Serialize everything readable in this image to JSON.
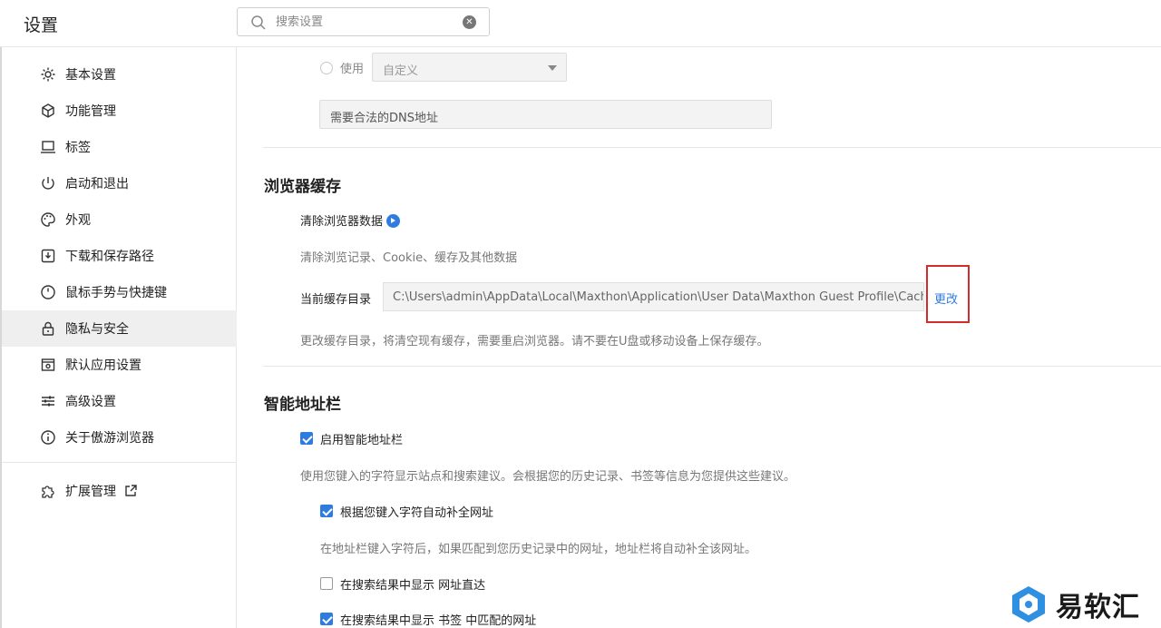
{
  "header": {
    "title": "设置",
    "search_placeholder": "搜索设置"
  },
  "sidebar": {
    "items": [
      {
        "label": "基本设置",
        "icon": "gear-icon"
      },
      {
        "label": "功能管理",
        "icon": "cube-icon"
      },
      {
        "label": "标签",
        "icon": "laptop-icon"
      },
      {
        "label": "启动和退出",
        "icon": "power-icon"
      },
      {
        "label": "外观",
        "icon": "palette-icon"
      },
      {
        "label": "下载和保存路径",
        "icon": "download-icon"
      },
      {
        "label": "鼠标手势与快捷键",
        "icon": "mouse-icon"
      },
      {
        "label": "隐私与安全",
        "icon": "lock-icon",
        "active": true
      },
      {
        "label": "默认应用设置",
        "icon": "default-app-icon"
      },
      {
        "label": "高级设置",
        "icon": "sliders-icon"
      },
      {
        "label": "关于傲游浏览器",
        "icon": "info-icon"
      }
    ],
    "extensions": {
      "label": "扩展管理",
      "icon": "puzzle-icon"
    }
  },
  "dns": {
    "radio_label": "使用",
    "select_value": "自定义",
    "input_placeholder": "需要合法的DNS地址"
  },
  "cache": {
    "title": "浏览器缓存",
    "clear_label": "清除浏览器数据",
    "clear_desc": "清除浏览记录、Cookie、缓存及其他数据",
    "dir_label": "当前缓存目录",
    "dir_value": "C:\\Users\\admin\\AppData\\Local\\Maxthon\\Application\\User Data\\Maxthon Guest Profile\\Cache",
    "change_label": "更改",
    "change_desc": "更改缓存目录，将清空现有缓存，需要重启浏览器。请不要在U盘或移动设备上保存缓存。"
  },
  "smartbar": {
    "title": "智能地址栏",
    "enable_label": "启用智能地址栏",
    "enable_checked": true,
    "enable_desc": "使用您键入的字符显示站点和搜索建议。会根据您的历史记录、书签等信息为您提供这些建议。",
    "autocomplete_label": "根据您键入字符自动补全网址",
    "autocomplete_checked": true,
    "autocomplete_desc": "在地址栏键入字符后，如果匹配到您历史记录中的网址，地址栏将自动补全该网址。",
    "direct_label": "在搜索结果中显示 网址直达",
    "direct_checked": false,
    "bookmark_label": "在搜索结果中显示 书签 中匹配的网址",
    "bookmark_checked": true
  },
  "watermark": {
    "text": "易软汇"
  },
  "colors": {
    "accent": "#2f7ce0",
    "highlight_border": "#d62b2b",
    "active_bg": "#efefef"
  }
}
